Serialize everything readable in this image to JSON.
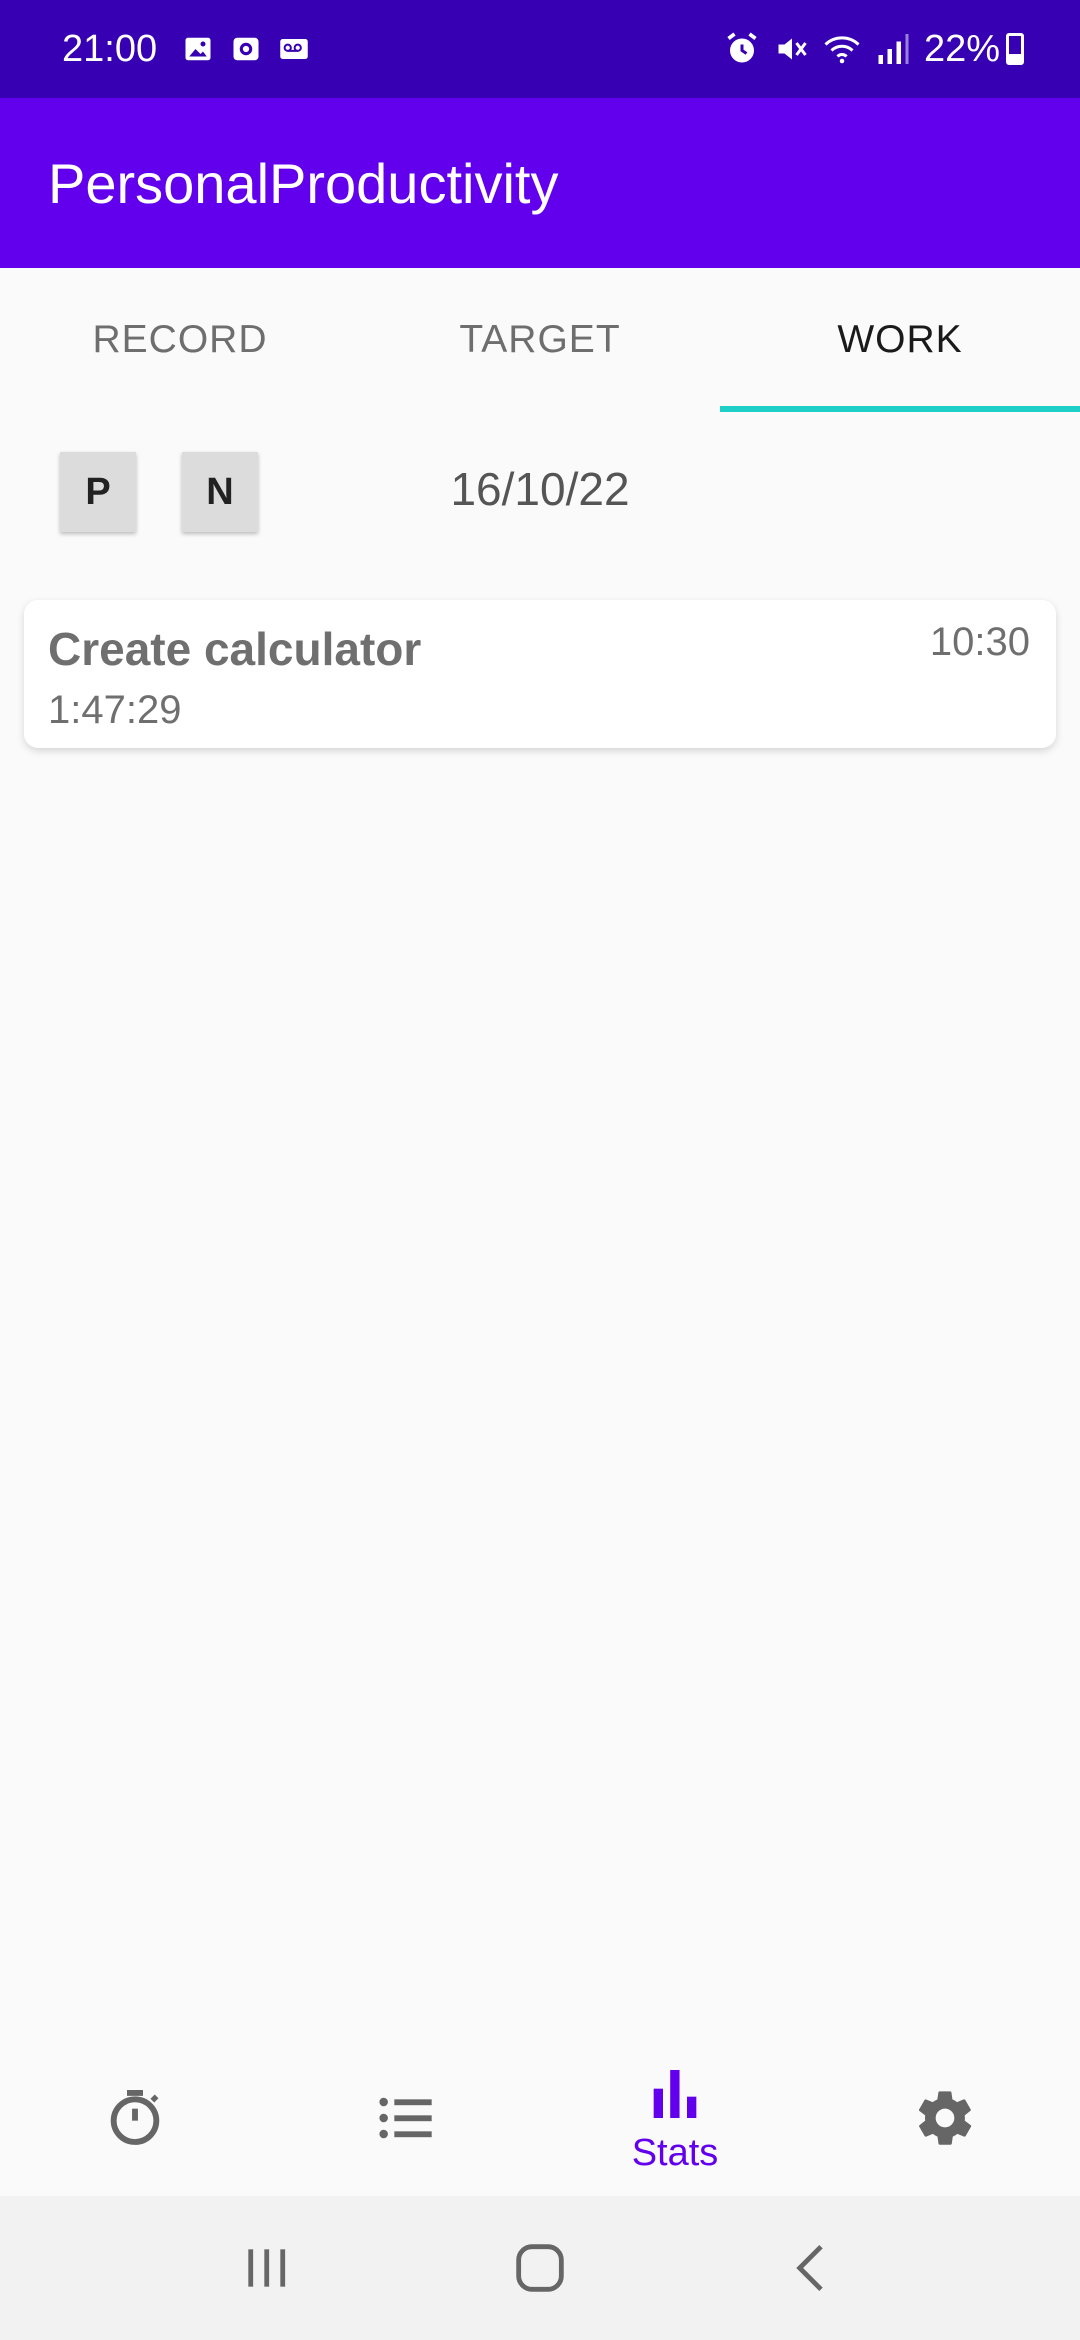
{
  "status_bar": {
    "time": "21:00",
    "battery": "22%",
    "left_icons": [
      "gallery-icon",
      "screen-record-icon",
      "voicemail-icon"
    ],
    "right_icons": [
      "alarm-icon",
      "mute-icon",
      "wifi-icon",
      "signal-icon",
      "battery-icon"
    ]
  },
  "app_bar": {
    "title": "PersonalProductivity"
  },
  "tabs": [
    {
      "label": "RECORD",
      "active": false
    },
    {
      "label": "TARGET",
      "active": false
    },
    {
      "label": "WORK",
      "active": true
    }
  ],
  "date_nav": {
    "prev_label": "P",
    "next_label": "N",
    "date": "16/10/22"
  },
  "entries": [
    {
      "title": "Create calculator",
      "duration": "1:47:29",
      "time": "10:30"
    }
  ],
  "bottom_nav": {
    "items": [
      {
        "icon": "timer-icon",
        "label": ""
      },
      {
        "icon": "list-icon",
        "label": ""
      },
      {
        "icon": "stats-icon",
        "label": "Stats",
        "active": true
      },
      {
        "icon": "settings-icon",
        "label": ""
      }
    ]
  },
  "colors": {
    "status_bar": "#3700b3",
    "app_bar": "#6200ee",
    "tab_indicator": "#1dcfc6",
    "active_nav": "#6200ee"
  }
}
